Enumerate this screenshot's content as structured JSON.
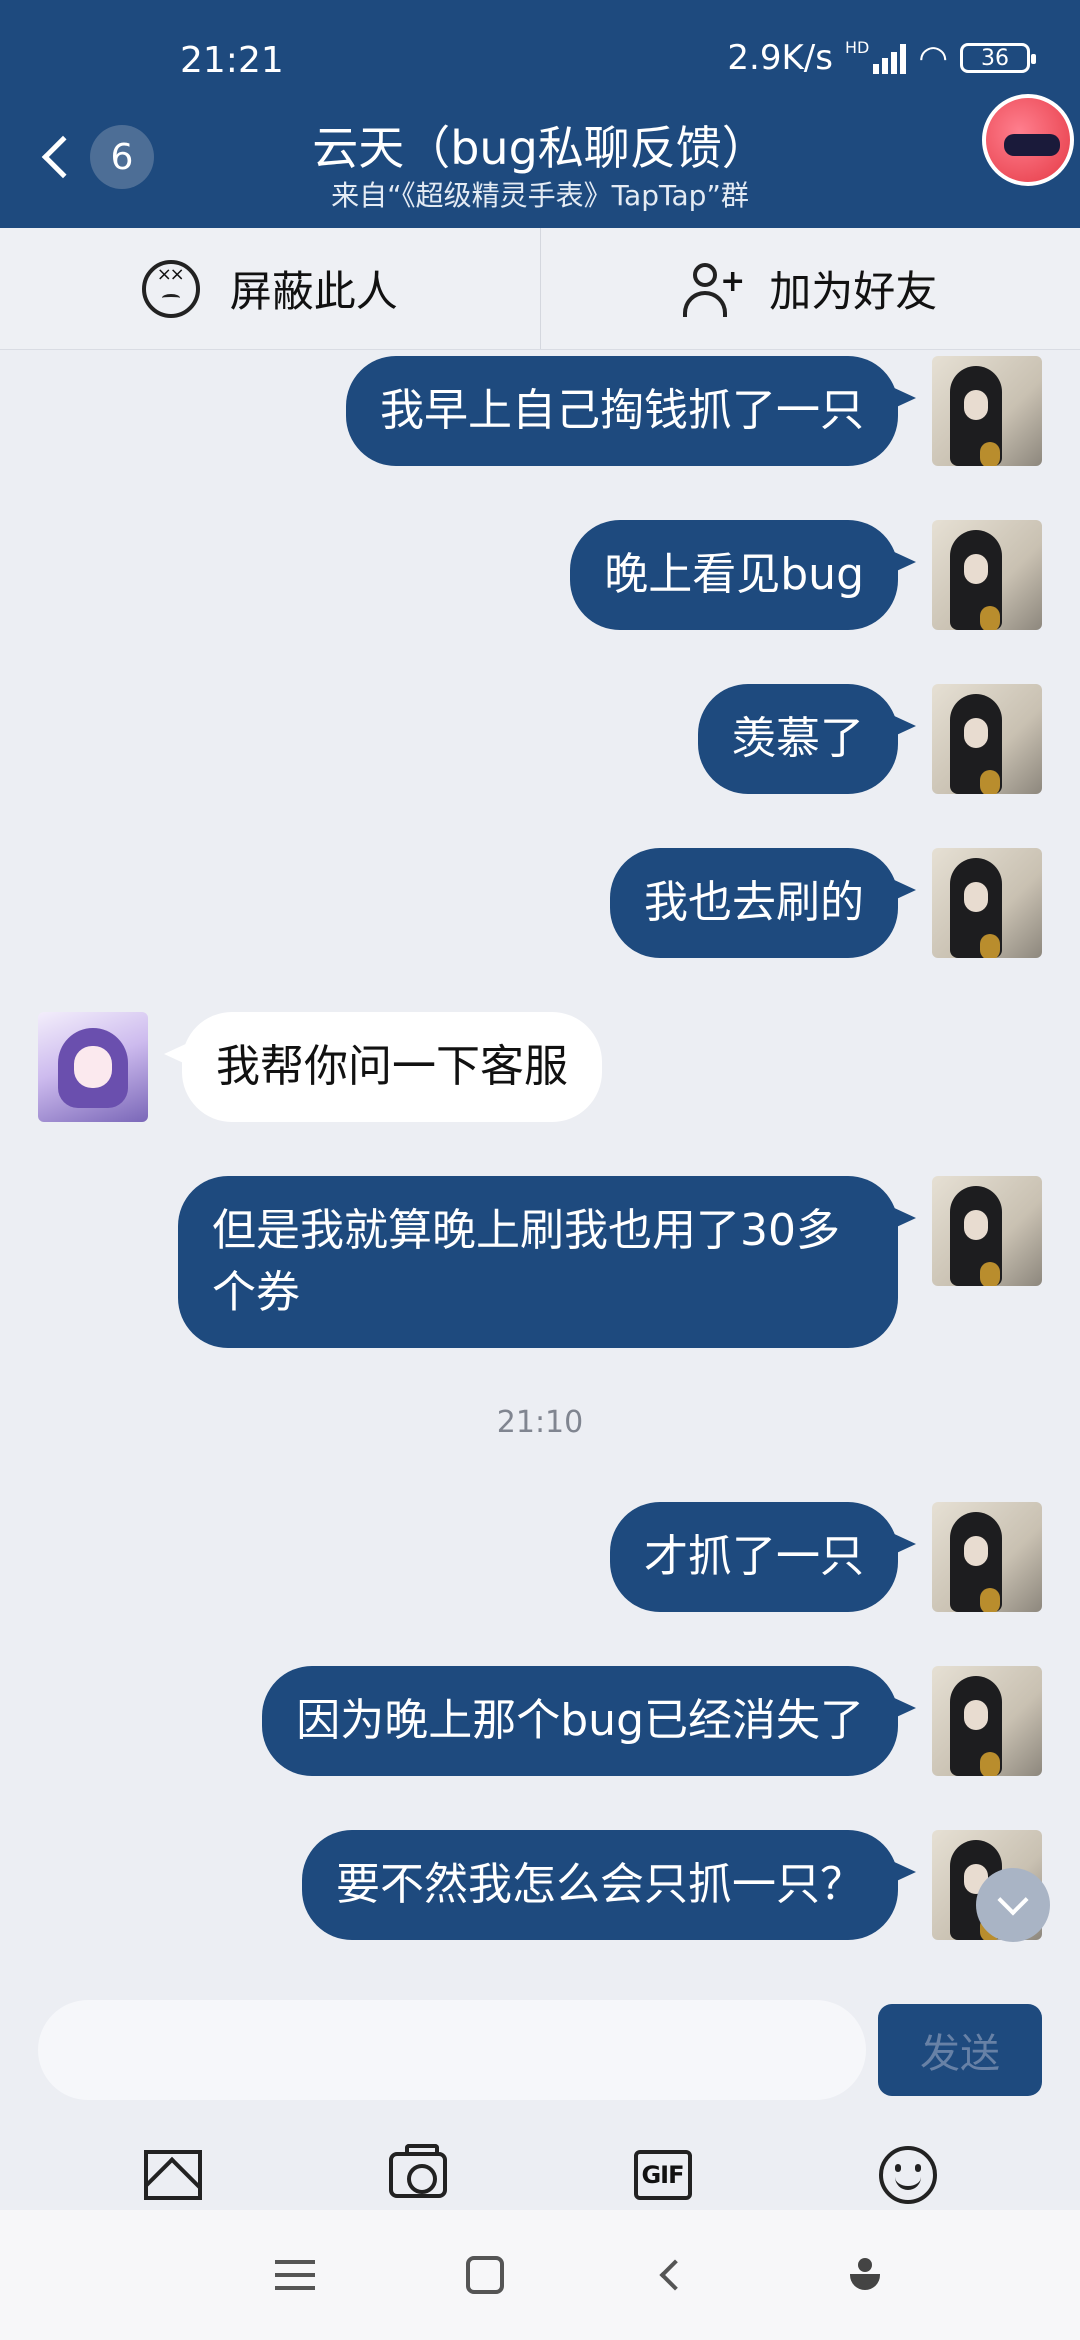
{
  "status_bar": {
    "time": "21:21",
    "network_speed": "2.9K/s",
    "network_type": "HD",
    "battery": "36"
  },
  "header": {
    "unread_count": "6",
    "title": "云天（bug私聊反馈）",
    "subtitle": "来自“《超级精灵手表》TapTap”群"
  },
  "actions": {
    "block_label": "屏蔽此人",
    "add_friend_label": "加为好友"
  },
  "messages": [
    {
      "from": "me",
      "text": "我早上自己掏钱抓了一只"
    },
    {
      "from": "me",
      "text": "晚上看见bug"
    },
    {
      "from": "me",
      "text": "羡慕了"
    },
    {
      "from": "me",
      "text": "我也去刷的"
    },
    {
      "from": "other",
      "text": "我帮你问一下客服"
    },
    {
      "from": "me",
      "text": "但是我就算晚上刷我也用了30多个券"
    },
    {
      "from": "me",
      "text": "才抓了一只"
    },
    {
      "from": "me",
      "text": "因为晚上那个bug已经消失了"
    },
    {
      "from": "me",
      "text": "要不然我怎么会只抓一只？"
    }
  ],
  "time_separator": "21:10",
  "composer": {
    "input_value": "",
    "send_label": "发送"
  },
  "toolbar": {
    "gif_label": "GIF"
  },
  "colors": {
    "header_bg": "#1e4a7e",
    "bubble_out": "#1e4a7e",
    "bubble_in": "#ffffff",
    "chat_bg": "#eceef3"
  }
}
